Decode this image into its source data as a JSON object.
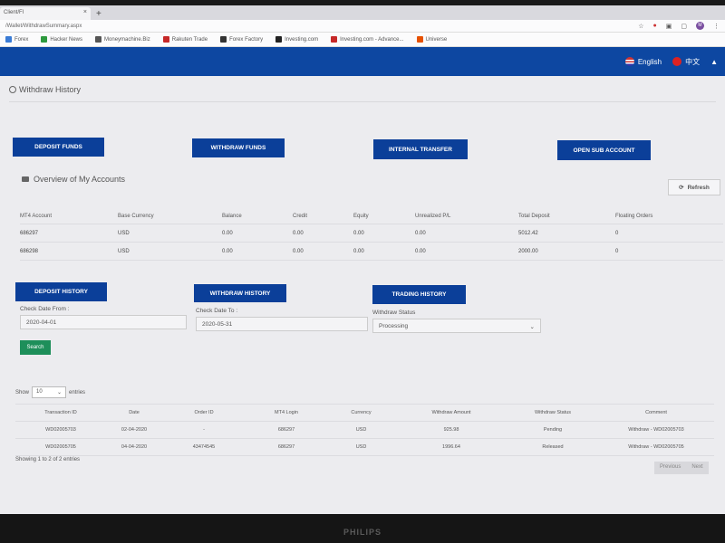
{
  "browser": {
    "tab_title": "Client/Fl",
    "url": "/Wallet/WithdrawSummary.aspx",
    "bookmarks": [
      {
        "label": "Forex",
        "color": "#3a7bd5"
      },
      {
        "label": "Hacker News",
        "color": "#2e9a3e"
      },
      {
        "label": "Moneymachine.Biz",
        "color": "#555555"
      },
      {
        "label": "Rakuten Trade",
        "color": "#c62828"
      },
      {
        "label": "Forex Factory",
        "color": "#333333"
      },
      {
        "label": "Investing.com",
        "color": "#222222"
      },
      {
        "label": "Investing.com - Advance...",
        "color": "#c62828"
      },
      {
        "label": "Universe",
        "color": "#e65100"
      }
    ]
  },
  "header": {
    "lang_english": "English",
    "lang_chinese": "中文"
  },
  "page_title": "Withdraw History",
  "action_buttons": {
    "deposit": "DEPOSIT FUNDS",
    "withdraw": "WITHDRAW FUNDS",
    "transfer": "INTERNAL TRANSFER",
    "sub_account": "OPEN SUB ACCOUNT"
  },
  "overview_title": "Overview of My Accounts",
  "refresh_label": "Refresh",
  "accounts": {
    "headers": [
      "MT4 Account",
      "Base Currency",
      "Balance",
      "Credit",
      "Equity",
      "Unrealized P/L",
      "Total Deposit",
      "Floating Orders"
    ],
    "rows": [
      [
        "686297",
        "USD",
        "0.00",
        "0.00",
        "0.00",
        "0.00",
        "5012.42",
        "0"
      ],
      [
        "686298",
        "USD",
        "0.00",
        "0.00",
        "0.00",
        "0.00",
        "2000.00",
        "0"
      ]
    ]
  },
  "history_buttons": {
    "deposit": "DEPOSIT HISTORY",
    "withdraw": "WITHDRAW HISTORY",
    "trading": "TRADING HISTORY"
  },
  "filters": {
    "date_from_label": "Check Date From :",
    "date_from": "2020-04-01",
    "date_to_label": "Check Date To :",
    "date_to": "2020-05-31",
    "status_label": "Withdraw Status",
    "status_value": "Processing",
    "search_label": "Search"
  },
  "entries": {
    "show": "Show",
    "count": "10",
    "entries": "entries"
  },
  "transactions": {
    "headers": [
      "Transaction ID",
      "Date",
      "Order ID",
      "MT4 Login",
      "Currency",
      "Withdraw Amount",
      "Withdraw Status",
      "Comment"
    ],
    "rows": [
      [
        "WD02005703",
        "02-04-2020",
        "-",
        "686297",
        "USD",
        "925.98",
        "Pending",
        "Withdraw - WD02005703"
      ],
      [
        "WD02005705",
        "04-04-2020",
        "43474545",
        "686297",
        "USD",
        "1996.64",
        "Released",
        "Withdraw - WD02005705"
      ]
    ]
  },
  "showing_text": "Showing 1 to 2 of 2 entries",
  "pager": {
    "previous": "Previous",
    "next": "Next"
  },
  "monitor_brand": "PHILIPS"
}
